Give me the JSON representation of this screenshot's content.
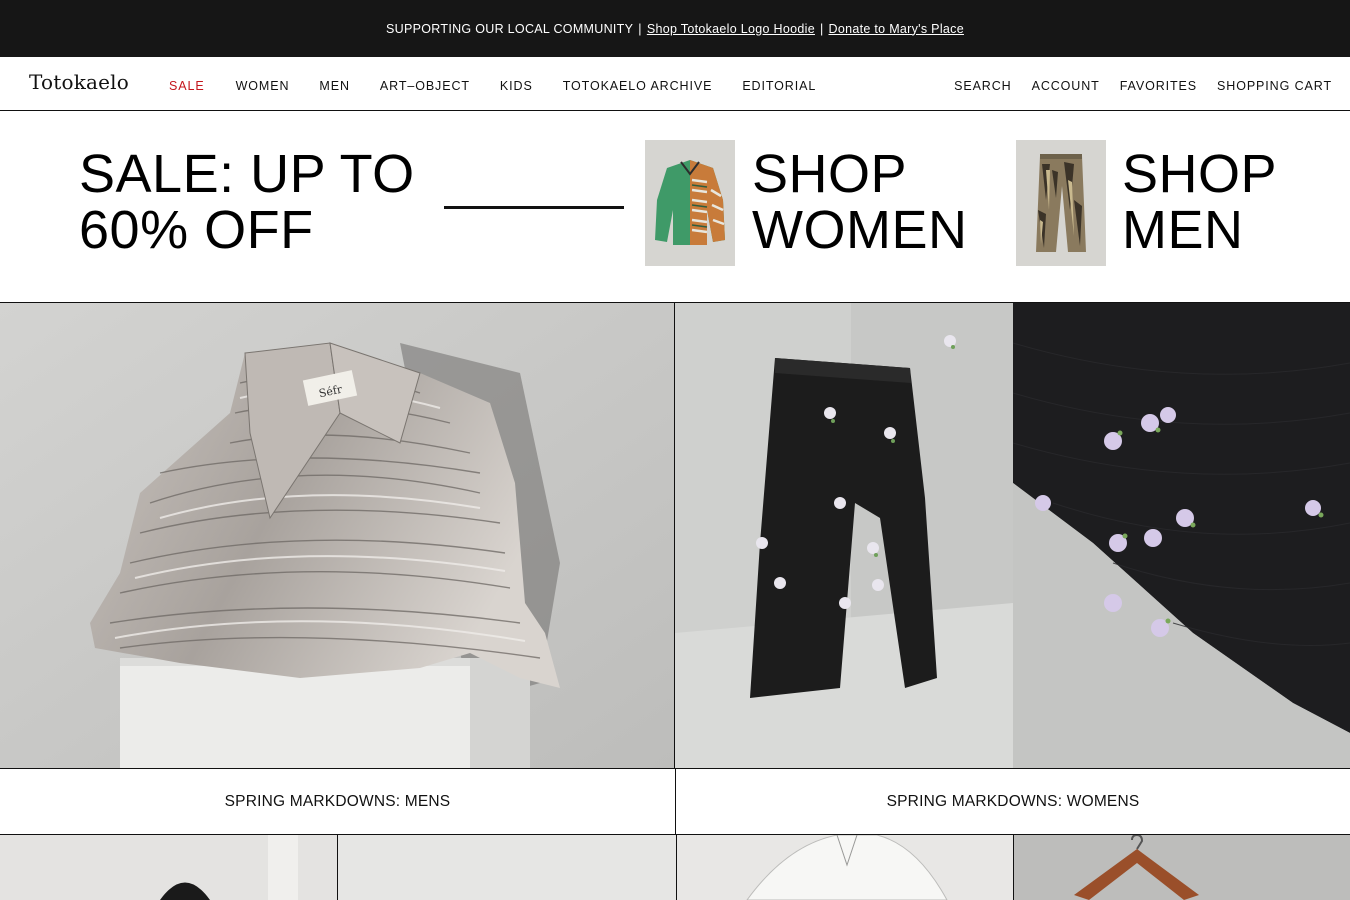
{
  "announcement": {
    "text": "SUPPORTING OUR LOCAL COMMUNITY",
    "separator": "|",
    "link1": "Shop Totokaelo Logo Hoodie",
    "link2": "Donate to Mary's Place"
  },
  "nav": {
    "logo": "Totokaelo",
    "left_items": [
      {
        "label": "SALE",
        "color": "#c4161c"
      },
      {
        "label": "WOMEN"
      },
      {
        "label": "MEN"
      },
      {
        "label": "ART–OBJECT"
      },
      {
        "label": "KIDS"
      },
      {
        "label": "TOTOKAELO ARCHIVE"
      },
      {
        "label": "EDITORIAL"
      }
    ],
    "right_items": [
      "SEARCH",
      "ACCOUNT",
      "FAVORITES",
      "SHOPPING CART"
    ]
  },
  "promo": {
    "sale_line1": "SALE: UP TO",
    "sale_line2": "60% OFF",
    "shop_women_line1": "SHOP",
    "shop_women_line2": "WOMEN",
    "shop_men_line1": "SHOP",
    "shop_men_line2": "MEN"
  },
  "features": {
    "shirt_label_tag": "Séfr",
    "caption_mens": "SPRING MARKDOWNS: MENS",
    "caption_womens": "SPRING MARKDOWNS: WOMENS"
  },
  "colors": {
    "accent_sale": "#c4161c",
    "announcement_bg": "#161616"
  }
}
